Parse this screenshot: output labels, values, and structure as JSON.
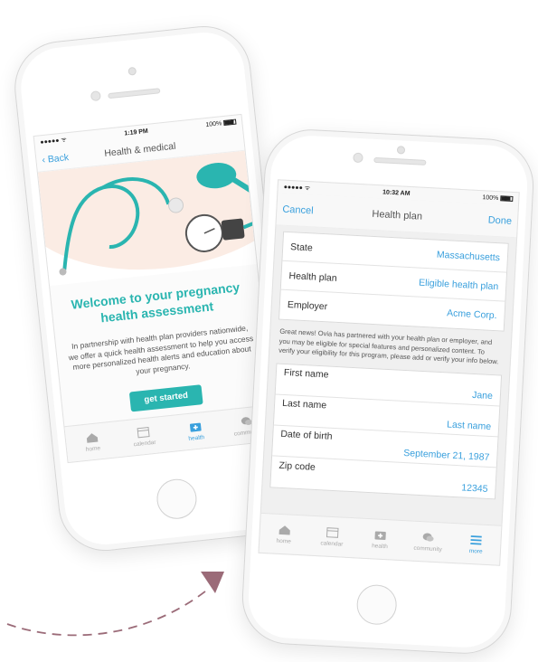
{
  "left_phone": {
    "status": {
      "carrier": "●●●●● ᯤ",
      "time": "1:19 PM",
      "battery": "100%"
    },
    "nav": {
      "back": "‹ Back",
      "title": "Health & medical"
    },
    "welcome_title": "Welcome to your pregnancy health assessment",
    "intro": "In partnership with health plan providers nationwide, we offer a quick health assessment to help you access more personalized health alerts and education about your pregnancy.",
    "cta": "get started",
    "tabs": [
      {
        "label": "home",
        "icon": "home-icon"
      },
      {
        "label": "calendar",
        "icon": "calendar-icon"
      },
      {
        "label": "health",
        "icon": "medical-kit-icon",
        "active": true
      },
      {
        "label": "community",
        "icon": "chat-bubbles-icon"
      }
    ]
  },
  "right_phone": {
    "status": {
      "carrier": "●●●●● ᯤ",
      "time": "10:32 AM",
      "battery": "100%"
    },
    "nav": {
      "cancel": "Cancel",
      "title": "Health plan",
      "done": "Done"
    },
    "plan_fields": [
      {
        "label": "State",
        "value": "Massachusetts"
      },
      {
        "label": "Health plan",
        "value": "Eligible health plan"
      },
      {
        "label": "Employer",
        "value": "Acme Corp."
      }
    ],
    "note": "Great news! Ovia has partnered with your health plan or employer, and you may be eligible for special features and personalized content. To verify your eligibility for this program, please add or verify your info below.",
    "personal_fields": [
      {
        "label": "First name",
        "value": "Jane"
      },
      {
        "label": "Last name",
        "value": "Last name"
      },
      {
        "label": "Date of birth",
        "value": "September 21, 1987"
      },
      {
        "label": "Zip code",
        "value": "12345"
      }
    ],
    "tabs": [
      {
        "label": "home",
        "icon": "home-icon"
      },
      {
        "label": "calendar",
        "icon": "calendar-icon"
      },
      {
        "label": "health",
        "icon": "medical-kit-icon"
      },
      {
        "label": "community",
        "icon": "chat-bubbles-icon"
      },
      {
        "label": "more",
        "icon": "menu-icon",
        "active": true
      }
    ]
  },
  "colors": {
    "teal": "#2ab5b0",
    "blue": "#3aa0dd",
    "arrow": "#9b6b78",
    "hero_bg": "#fbece4"
  }
}
